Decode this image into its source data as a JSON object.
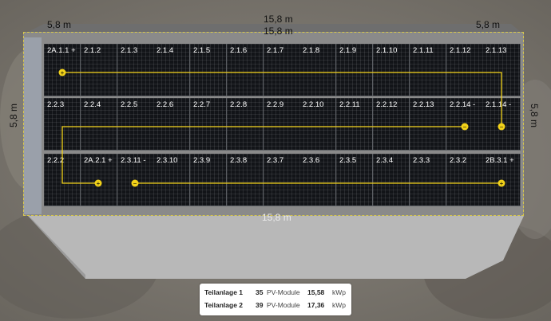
{
  "dimensions": {
    "top_left": "5,8 m",
    "top_center": "15,8 m",
    "top_inner": "15,8 m",
    "top_right": "5,8 m",
    "left": "5,8 m",
    "right": "5,8 m",
    "bottom": "15,8 m"
  },
  "rows": [
    [
      "2A.1.1 +",
      "2.1.2",
      "2.1.3",
      "2.1.4",
      "2.1.5",
      "2.1.6",
      "2.1.7",
      "2.1.8",
      "2.1.9",
      "2.1.10",
      "2.1.11",
      "2.1.12",
      "2.1.13"
    ],
    [
      "2.2.3",
      "2.2.4",
      "2.2.5",
      "2.2.6",
      "2.2.7",
      "2.2.8",
      "2.2.9",
      "2.2.10",
      "2.2.11",
      "2.2.12",
      "2.2.13",
      "2.2.14 -",
      "2.1.14 -"
    ],
    [
      "2.2.2",
      "2A.2.1 +",
      "2.3.11 -",
      "2.3.10",
      "2.3.9",
      "2.3.8",
      "2.3.7",
      "2.3.6",
      "2.3.5",
      "2.3.4",
      "2.3.3",
      "2.3.2",
      "2B.3.1 +"
    ]
  ],
  "legend": [
    {
      "name": "Teilanlage 1",
      "count": "35",
      "unit": "PV-Module",
      "kwp": "15,58",
      "kwp_unit": "kWp"
    },
    {
      "name": "Teilanlage 2",
      "count": "39",
      "unit": "PV-Module",
      "kwp": "17,36",
      "kwp_unit": "kWp"
    }
  ],
  "colors": {
    "string_line": "#f2d21a",
    "module": "#121418",
    "roof_edge": "#d8c84a"
  }
}
